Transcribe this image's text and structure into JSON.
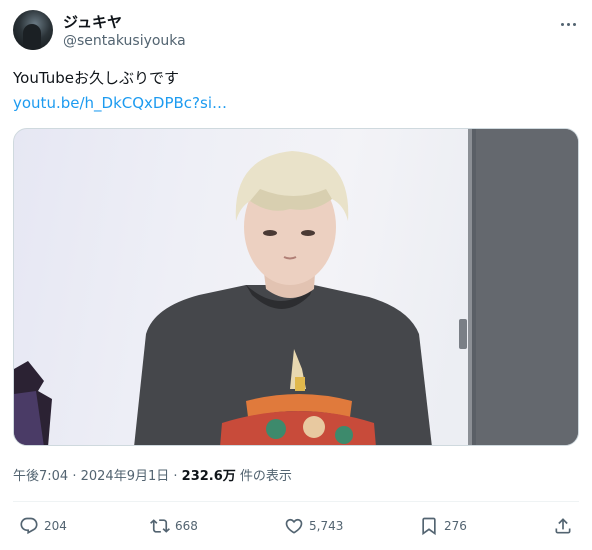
{
  "author": {
    "display_name": "ジュキヤ",
    "handle": "@sentakusiyouka"
  },
  "tweet": {
    "text": "YouTubeお久しぶりです",
    "link": "youtu.be/h_DkCQxDPBc?si…"
  },
  "meta": {
    "time": "午後7:04",
    "separator1": " · ",
    "date": "2024年9月1日",
    "separator2": " · ",
    "views_count": "232.6万",
    "views_suffix": " 件の表示"
  },
  "actions": {
    "replies": "204",
    "reposts": "668",
    "likes": "5,743",
    "bookmarks": "276"
  },
  "icons": [
    "avatar",
    "more-icon",
    "reply-icon",
    "repost-icon",
    "like-icon",
    "bookmark-icon",
    "share-icon"
  ],
  "colors": {
    "text": "#0f1419",
    "secondary": "#536471",
    "link": "#1d9bf0",
    "border": "#cfd9de"
  }
}
